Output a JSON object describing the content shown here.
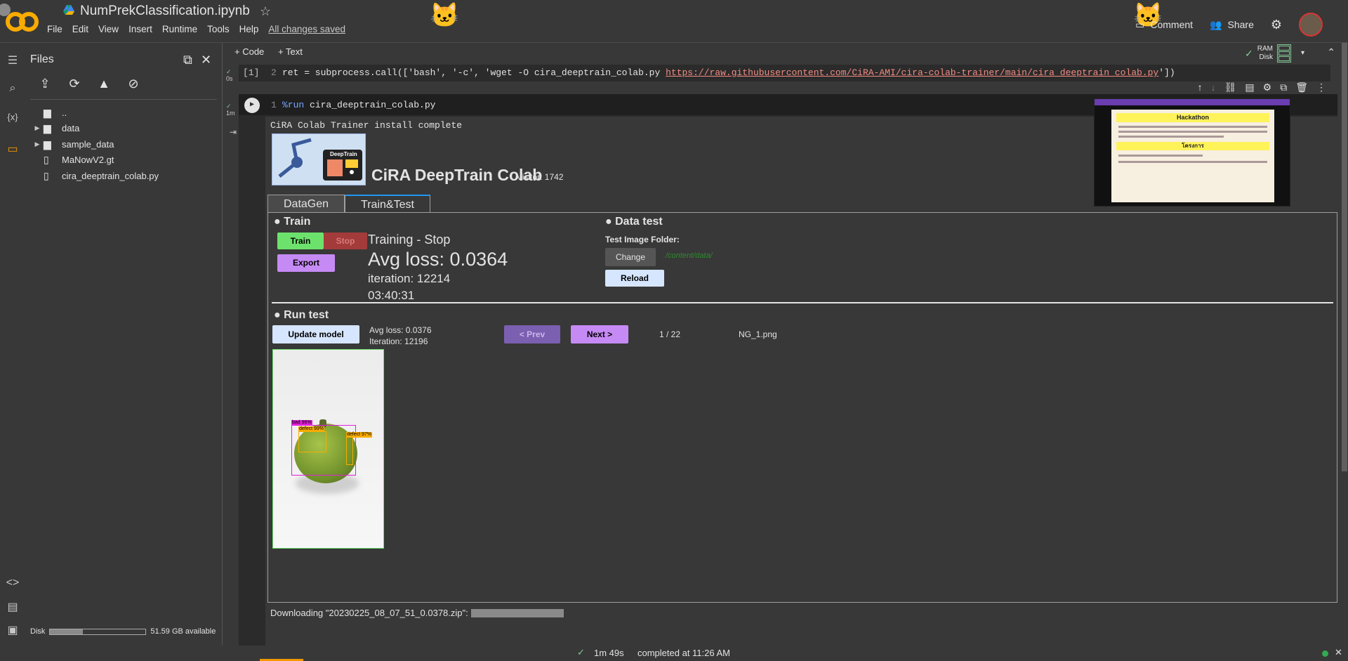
{
  "header": {
    "title": "NumPrekClassification.ipynb",
    "menu": [
      "File",
      "Edit",
      "View",
      "Insert",
      "Runtime",
      "Tools",
      "Help"
    ],
    "saved": "All changes saved",
    "comment": "Comment",
    "share": "Share"
  },
  "rail": {
    "icons": [
      "menu-icon",
      "search-icon",
      "variables-icon",
      "folder-icon",
      "code-snippets-icon",
      "command-palette-icon",
      "terminal-icon"
    ]
  },
  "files": {
    "title": "Files",
    "items": [
      {
        "name": "..",
        "type": "folder-up"
      },
      {
        "name": "data",
        "type": "folder"
      },
      {
        "name": "sample_data",
        "type": "folder"
      },
      {
        "name": "MaNowV2.gt",
        "type": "file"
      },
      {
        "name": "cira_deeptrain_colab.py",
        "type": "file"
      }
    ],
    "disk_label": "Disk",
    "disk_avail": "51.59 GB available",
    "disk_used_fraction": 0.34
  },
  "toolbar": {
    "code": "+ Code",
    "text": "+ Text",
    "ram": "RAM",
    "disk": "Disk"
  },
  "cell1": {
    "exec": "[1]",
    "time": "0s",
    "line": "2",
    "code": "ret = subprocess.call(['bash', '-c', 'wget -O  cira_deeptrain_colab.py ",
    "url": "https://raw.githubusercontent.com/CiRA-AMI/cira-colab-trainer/main/cira_deeptrain_colab.py",
    "end": "'])"
  },
  "cell2": {
    "time": "1m",
    "line": "1",
    "magic": "%run",
    "code": " cira_deeptrain_colab.py"
  },
  "output": {
    "install": "CiRA Colab Trainer install complete",
    "logo_text": "DeepTrain",
    "title": "CiRA DeepTrain Colab",
    "visitor": "Visitor: 1742",
    "tabs": [
      "DataGen",
      "Train&Test"
    ],
    "train": {
      "header": "Train",
      "train_btn": "Train",
      "stop_btn": "Stop",
      "export_btn": "Export",
      "status": "Training - Stop",
      "avg_loss": "Avg loss: 0.0364",
      "iteration": "iteration: 12214",
      "time": "03:40:31"
    },
    "datatest": {
      "header": "Data test",
      "folder_label": "Test Image Folder:",
      "change_btn": "Change",
      "path": "/content/data/",
      "reload_btn": "Reload"
    },
    "runtest": {
      "header": "Run test",
      "update_btn": "Update model",
      "avg_loss": "Avg loss: 0.0376",
      "iteration": "Iteration: 12196",
      "prev_btn": "< Prev",
      "next_btn": "Next >",
      "page": "1 / 22",
      "filename": "NG_1.png",
      "labels": [
        "bad 96%",
        "defect 99%",
        "defect 97%"
      ]
    },
    "downloading": "Downloading \"20230225_08_07_51_0.0378.zip\":"
  },
  "pip": {
    "heading": "Hackathon",
    "subheading": "โครงการ"
  },
  "status": {
    "elapsed": "1m 49s",
    "completed": "completed at 11:26 AM"
  },
  "colors": {
    "train": "#6ce26c",
    "stop": "#a33b3b",
    "export": "#c68af5",
    "reload": "#d6e6ff",
    "prev": "#7b5fb0",
    "next": "#c68af5",
    "path": "#2e8b2e"
  }
}
